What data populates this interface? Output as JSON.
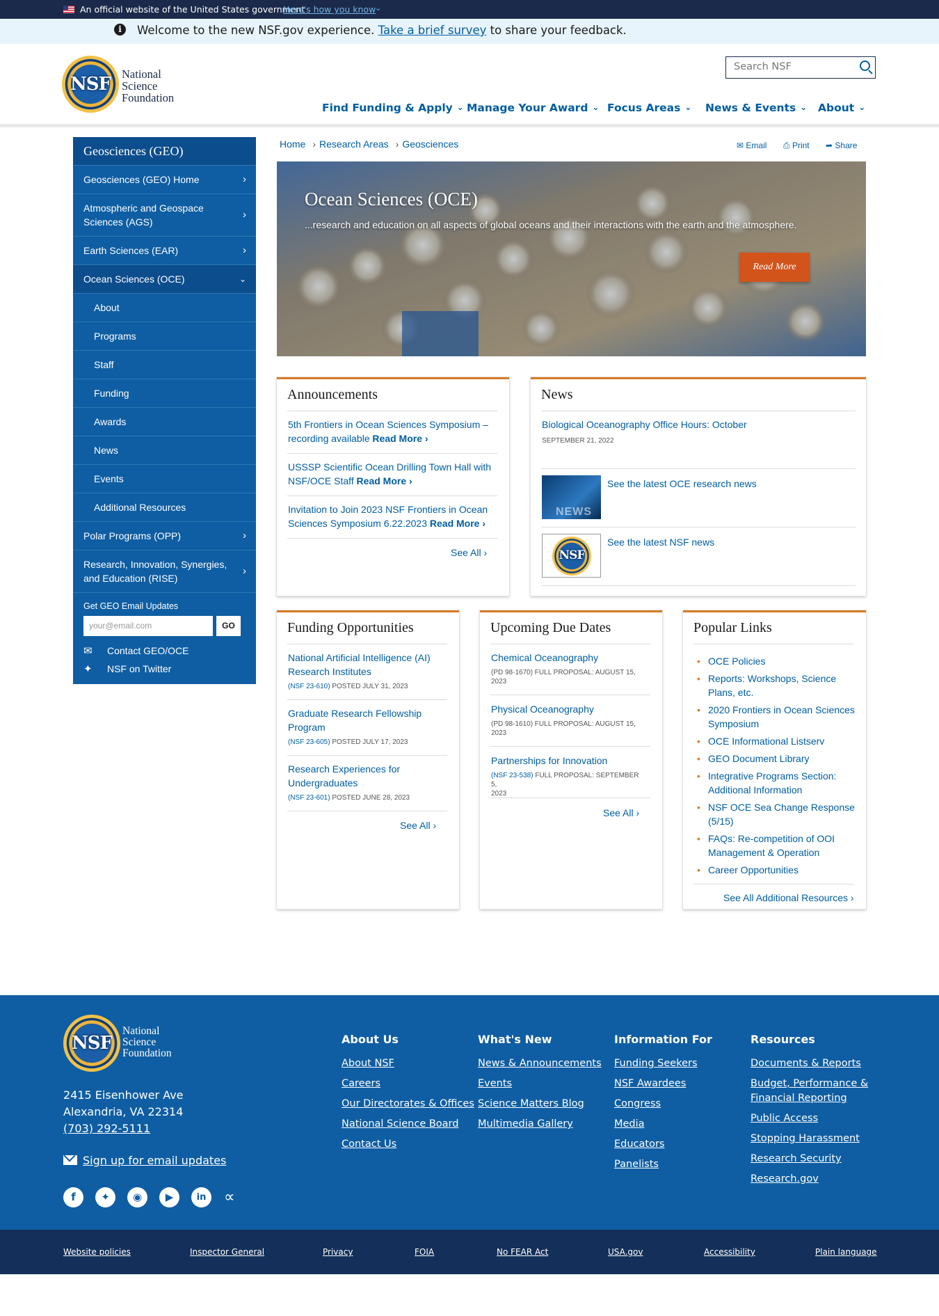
{
  "gov_banner": {
    "text": "An official website of the United States government",
    "how_link": "Here's how you know"
  },
  "survey": {
    "before": "Welcome to the new NSF.gov experience. ",
    "link": "Take a brief survey",
    "after": " to share your feedback."
  },
  "logo": {
    "line1": "National",
    "line2": "Science",
    "line3": "Foundation",
    "seal_text": "NSF"
  },
  "search": {
    "placeholder": "Search NSF"
  },
  "nav": [
    {
      "label": "Find Funding & Apply"
    },
    {
      "label": "Manage Your Award"
    },
    {
      "label": "Focus Areas"
    },
    {
      "label": "News & Events"
    },
    {
      "label": "About"
    }
  ],
  "sidebar": {
    "title": "Geosciences (GEO)",
    "items": [
      {
        "label": "Geosciences (GEO) Home"
      },
      {
        "label": "Atmospheric and Geospace Sciences (AGS)"
      },
      {
        "label": "Earth Sciences (EAR)"
      },
      {
        "label": "Ocean Sciences (OCE)"
      },
      {
        "label": "About"
      },
      {
        "label": "Programs"
      },
      {
        "label": "Staff"
      },
      {
        "label": "Funding"
      },
      {
        "label": "Awards"
      },
      {
        "label": "News"
      },
      {
        "label": "Events"
      },
      {
        "label": "Additional Resources"
      },
      {
        "label": "Polar Programs (OPP)"
      },
      {
        "label": "Research, Innovation, Synergies, and Education (RISE)"
      }
    ],
    "updates_label": "Get GEO Email Updates",
    "email_placeholder": "your@email.com",
    "go_label": "GO",
    "contact": "Contact GEO/OCE",
    "twitter": "NSF on Twitter"
  },
  "breadcrumb": [
    "Home",
    "Research Areas",
    "Geosciences"
  ],
  "share": {
    "email": "Email",
    "print": "Print",
    "share": "Share"
  },
  "hero": {
    "title": "Ocean Sciences (OCE)",
    "text": "...research and education on all aspects of global oceans and their interactions with the earth and the atmosphere.",
    "button": "Read More"
  },
  "announcements": {
    "title": "Announcements",
    "items": [
      {
        "line1": "5th Frontiers in Ocean Sciences Symposium –",
        "line2": "recording available ",
        "more": "Read More ›"
      },
      {
        "line1": "USSSP Scientific Ocean Drilling Town Hall with",
        "line2": "NSF/OCE Staff ",
        "more": "Read More ›"
      },
      {
        "line1": "Invitation to Join 2023 NSF Frontiers in Ocean",
        "line2": "Sciences Symposium 6.22.2023 ",
        "more": "Read More ›"
      }
    ],
    "see_all": "See All ›"
  },
  "news": {
    "title": "News",
    "item1": {
      "title": "Biological Oceanography Office Hours: October",
      "date": "SEPTEMBER 21, 2022"
    },
    "item2": {
      "title": "See the latest OCE research news",
      "thumb_text": "NEWS"
    },
    "item3": {
      "title": "See the latest NSF news"
    }
  },
  "funding": {
    "title": "Funding Opportunities",
    "items": [
      {
        "line1": "National Artificial Intelligence (AI)",
        "line2": "Research Institutes",
        "num": "(NSF 23-610)",
        "posted": " POSTED JULY 31, 2023"
      },
      {
        "line1": "Graduate Research Fellowship",
        "line2": "Program",
        "num": "(NSF 23-605)",
        "posted": " POSTED JULY 17, 2023"
      },
      {
        "line1": "Research Experiences for",
        "line2": "Undergraduates",
        "num": "(NSF 23-601)",
        "posted": " POSTED JUNE 28, 2023"
      }
    ],
    "see_all": "See All ›"
  },
  "due_dates": {
    "title": "Upcoming Due Dates",
    "items": [
      {
        "title": "Chemical Oceanography",
        "num": "(PD  98-1670)",
        "m1": " FULL PROPOSAL: AUGUST 15,",
        "m2": "2023"
      },
      {
        "title": "Physical Oceanography",
        "num": "(PD  98-1610)",
        "m1": " FULL PROPOSAL: AUGUST 15,",
        "m2": "2023"
      },
      {
        "title": "Partnerships for Innovation",
        "num": "(NSF 23-538)",
        "m1": " FULL PROPOSAL: SEPTEMBER 5,",
        "m2": "2023"
      }
    ],
    "see_all": "See All ›"
  },
  "popular": {
    "title": "Popular Links",
    "items": [
      {
        "l1": "OCE Policies",
        "l2": ""
      },
      {
        "l1": "Reports: Workshops, Science",
        "l2": "Plans, etc."
      },
      {
        "l1": "2020 Frontiers in Ocean Sciences",
        "l2": "Symposium"
      },
      {
        "l1": "OCE Informational Listserv",
        "l2": ""
      },
      {
        "l1": "GEO Document Library",
        "l2": ""
      },
      {
        "l1": "Integrative Programs Section:",
        "l2": "Additional Information"
      },
      {
        "l1": "NSF OCE Sea Change Response",
        "l2": "(5/15)"
      },
      {
        "l1": "FAQs: Re-competition of OOI",
        "l2": "Management & Operation"
      },
      {
        "l1": "Career Opportunities",
        "l2": ""
      }
    ],
    "see_all": "See All Additional Resources ›"
  },
  "footer": {
    "address1": "2415 Eisenhower Ave",
    "address2": "Alexandria, VA 22314",
    "phone": "(703) 292-5111",
    "signup": "Sign up for email updates",
    "cols": [
      {
        "title": "About Us",
        "links": [
          "About NSF",
          "Careers",
          "Our Directorates & Offices",
          "National Science Board",
          "Contact Us"
        ]
      },
      {
        "title": "What's New",
        "links": [
          "News & Announcements",
          "Events",
          "Science Matters Blog",
          "Multimedia Gallery"
        ]
      },
      {
        "title": "Information For",
        "links": [
          "Funding Seekers",
          "NSF Awardees",
          "Congress",
          "Media",
          "Educators",
          "Panelists"
        ]
      },
      {
        "title": "Resources",
        "links": [
          "Documents & Reports",
          "Budget, Performance & Financial Reporting",
          "Public Access",
          "Stopping Harassment",
          "Research Security",
          "Research.gov"
        ]
      }
    ],
    "bottom_links": [
      "Website policies",
      "Inspector General",
      "Privacy",
      "FOIA",
      "No FEAR Act",
      "USA.gov",
      "Accessibility",
      "Plain language"
    ]
  },
  "colors": {
    "brand_blue": "#005ea2",
    "sidebar_blue": "#0f5ea3",
    "accent_orange": "#d77b25",
    "button_orange": "#d2541b"
  }
}
